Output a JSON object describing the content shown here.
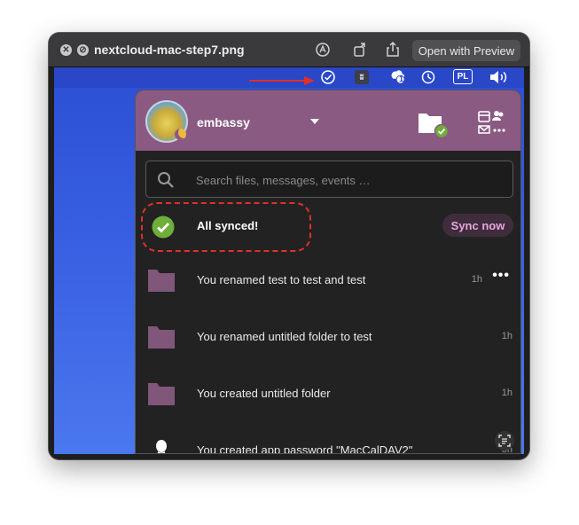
{
  "window": {
    "title": "nextcloud-mac-step7.png",
    "open_with_label": "Open with Preview",
    "icons": [
      "close-icon",
      "reject-icon",
      "markup-icon",
      "rotate-icon",
      "share-icon"
    ]
  },
  "menubar": {
    "icons": [
      "sync-status-icon",
      "app-icon",
      "notification-icon",
      "time-machine-icon",
      "input-source-icon",
      "volume-icon"
    ],
    "input_source_label": "PL",
    "notification_badge": "1"
  },
  "account": {
    "name": "embassy",
    "status_icon": "moon-icon"
  },
  "search": {
    "placeholder": "Search files, messages, events …"
  },
  "sync": {
    "status": "All synced!",
    "button_label": "Sync now"
  },
  "activities": [
    {
      "text": "You renamed test to test and test",
      "time": "1h",
      "icon": "folder-icon",
      "has_more": true,
      "more_label": "•••"
    },
    {
      "text": "You renamed untitled folder to test",
      "time": "1h",
      "icon": "folder-icon"
    },
    {
      "text": "You created untitled folder",
      "time": "1h",
      "icon": "folder-icon"
    },
    {
      "text": "You created app password \"MacCalDAV2\"",
      "time": "5h",
      "icon": "person-icon"
    }
  ],
  "colors": {
    "header": "#8a5a83",
    "panel": "#222222",
    "sync_ok": "#6fae38",
    "sync_button_text": "#e9a6dd",
    "highlight": "#e0302a",
    "desktop": "#3b63e4"
  }
}
